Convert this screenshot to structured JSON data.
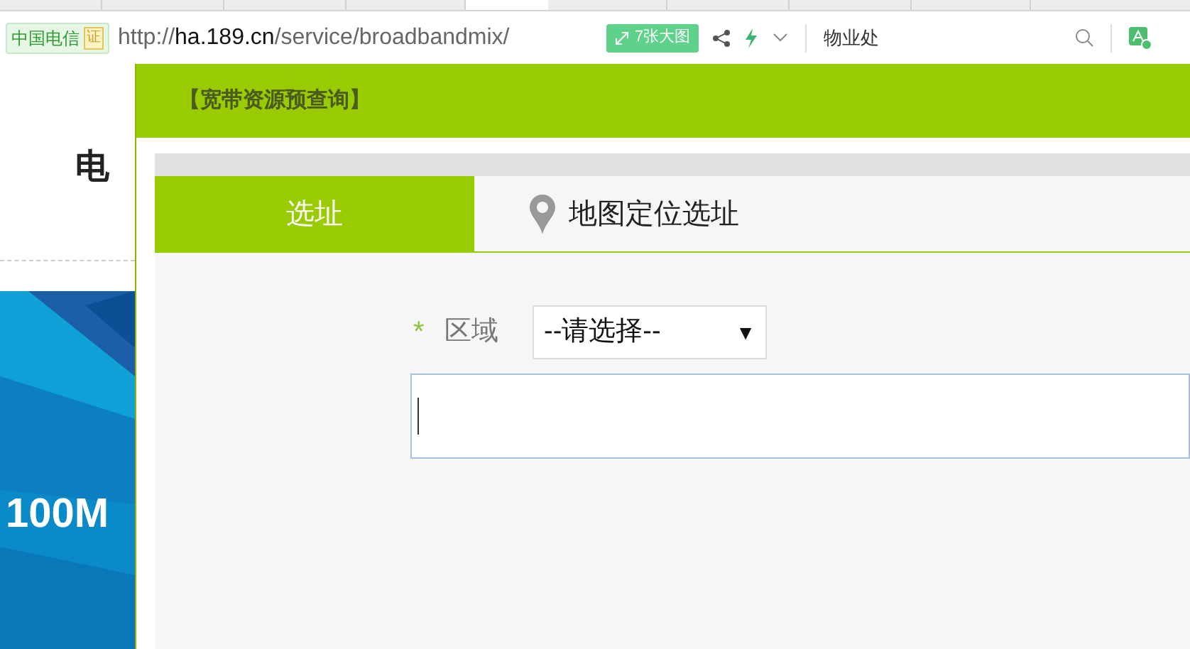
{
  "address_bar": {
    "site_badge": "中国电信",
    "cert_badge": "证",
    "url": {
      "scheme": "http://",
      "host": "ha.189.cn",
      "path": "/service/broadbandmix/"
    },
    "images_button": "7张大图",
    "search_value": "物业处"
  },
  "background_page": {
    "heading": "电",
    "banner_text": "100M"
  },
  "dialog": {
    "title": "【宽带资源预查询】",
    "tabs": [
      {
        "label": "选址",
        "selected": true,
        "kind": "plain"
      },
      {
        "label": "地图定位选址",
        "selected": false,
        "kind": "pin"
      }
    ],
    "form": {
      "required_mark": "*",
      "region_label": "区域",
      "region_select": "--请选择--",
      "select_arrow": "▼",
      "address_field": {
        "focused": true
      }
    }
  }
}
